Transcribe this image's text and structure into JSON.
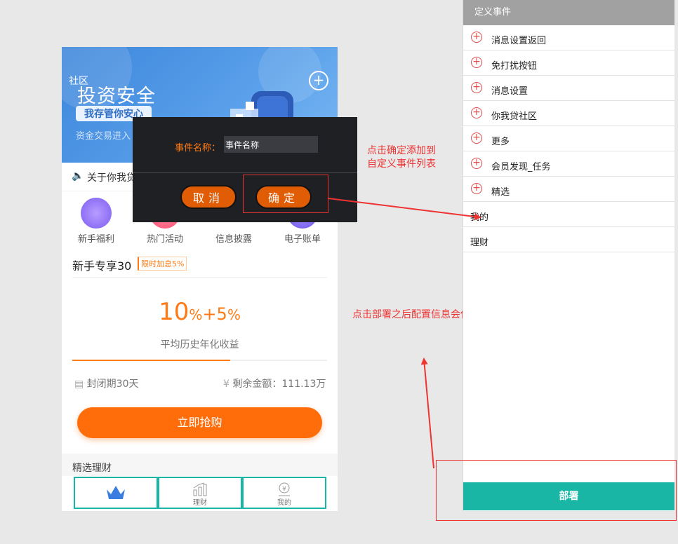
{
  "phone": {
    "banner": {
      "community_tag": "社区",
      "title": "投资安全",
      "subtitle": "我存管你安心",
      "small_text": "资金交易进入"
    },
    "notice_text": "关于你我贷",
    "tiles": [
      {
        "label": "新手福利",
        "color": "#8a6cf4"
      },
      {
        "label": "热门活动",
        "color": "#ff5a7a"
      },
      {
        "label": "信息披露",
        "color": "#ffffff"
      },
      {
        "label": "电子账单",
        "color": "#7b63f0"
      }
    ],
    "product": {
      "title": "新手专享30",
      "badge": "限时加息5%",
      "rate_main": "10",
      "rate_pct1": "%",
      "rate_plus": "+5",
      "rate_pct2": "%",
      "rate_label": "平均历史年化收益",
      "progress": 0.62,
      "closed_period": "封闭期30天",
      "remaining": "剩余金额：111.13万",
      "buy_label": "立即抢购"
    },
    "section_label": "精选理财",
    "bottom_nav": [
      {
        "label": "",
        "icon": "crown-icon",
        "active": true
      },
      {
        "label": "理财",
        "icon": "chart-icon",
        "active": false
      },
      {
        "label": "我的",
        "icon": "yen-icon",
        "active": false
      }
    ]
  },
  "dialog": {
    "label": "事件名称：",
    "input_value": "事件名称",
    "cancel": "取消",
    "confirm": "确定"
  },
  "annotations": {
    "confirm_note": "点击确定添加到自定义事件列表",
    "deploy_note": "点击部署之后配置信息会保存到服务器"
  },
  "panel": {
    "header": "定义事件",
    "items": [
      {
        "label": "消息设置返回",
        "has_add": true
      },
      {
        "label": "免打扰按钮",
        "has_add": true
      },
      {
        "label": "消息设置",
        "has_add": true
      },
      {
        "label": "你我贷社区",
        "has_add": true
      },
      {
        "label": "更多",
        "has_add": true
      },
      {
        "label": "会员发现_任务",
        "has_add": true
      },
      {
        "label": "精选",
        "has_add": true
      },
      {
        "label": "我的",
        "has_add": false
      },
      {
        "label": "理财",
        "has_add": false
      }
    ],
    "deploy": "部署"
  },
  "colors": {
    "accent_orange": "#ff6c0a",
    "teal": "#19b5a5",
    "annotation_red": "#e33333"
  }
}
